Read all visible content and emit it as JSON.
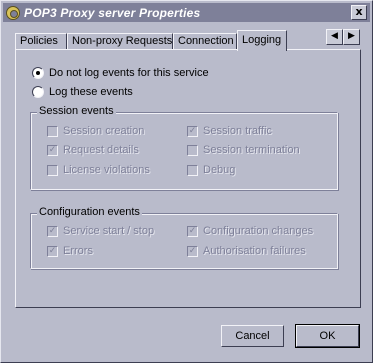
{
  "window": {
    "title": "POP3 Proxy server Properties",
    "close_glyph": "x"
  },
  "tabs": [
    {
      "label": "Policies",
      "active": false
    },
    {
      "label": "Non-proxy Requests",
      "active": false
    },
    {
      "label": "Connection",
      "active": false
    },
    {
      "label": "Logging",
      "active": true
    }
  ],
  "tab_scroll": {
    "left": "◀",
    "right": "▶"
  },
  "logging": {
    "option_no_log": "Do not log events for this service",
    "option_log": "Log these events",
    "selected": "no_log"
  },
  "session_events": {
    "label": "Session events",
    "items": [
      {
        "label": "Session creation",
        "checked": false,
        "enabled": false
      },
      {
        "label": "Session traffic",
        "checked": true,
        "enabled": false
      },
      {
        "label": "Request details",
        "checked": true,
        "enabled": false
      },
      {
        "label": "Session termination",
        "checked": false,
        "enabled": false
      },
      {
        "label": "License violations",
        "checked": false,
        "enabled": false
      },
      {
        "label": "Debug",
        "checked": false,
        "enabled": false
      }
    ]
  },
  "configuration_events": {
    "label": "Configuration events",
    "items": [
      {
        "label": "Service start / stop",
        "checked": true,
        "enabled": false
      },
      {
        "label": "Configuration changes",
        "checked": true,
        "enabled": false
      },
      {
        "label": "Errors",
        "checked": true,
        "enabled": false
      },
      {
        "label": "Authorisation failures",
        "checked": true,
        "enabled": false
      }
    ]
  },
  "buttons": {
    "cancel": "Cancel",
    "ok": "OK"
  },
  "check_glyph": "✓"
}
